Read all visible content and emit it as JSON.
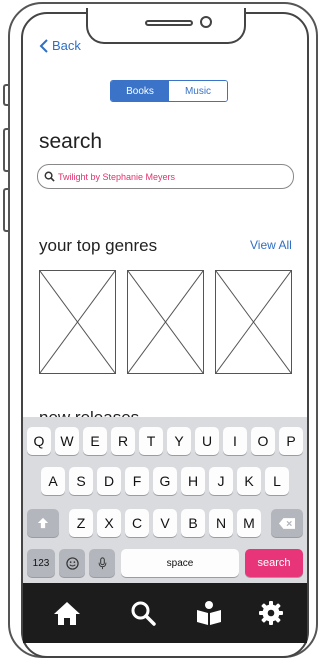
{
  "nav": {
    "back_label": "Back"
  },
  "segmented": {
    "options": [
      "Books",
      "Music"
    ],
    "selected": "Books"
  },
  "search": {
    "heading": "search",
    "query": "Twilight by Stephanie Meyers"
  },
  "genres": {
    "heading": "your top genres",
    "view_all_label": "View All",
    "tiles": 3
  },
  "new_releases": {
    "heading": "new releases"
  },
  "keyboard": {
    "row1": [
      "Q",
      "W",
      "E",
      "R",
      "T",
      "Y",
      "U",
      "I",
      "O",
      "P"
    ],
    "row2": [
      "A",
      "S",
      "D",
      "F",
      "G",
      "H",
      "J",
      "K",
      "L"
    ],
    "row3": [
      "Z",
      "X",
      "C",
      "V",
      "B",
      "N",
      "M"
    ],
    "numbers_label": "123",
    "space_label": "space",
    "search_label": "search"
  },
  "tabbar": {
    "items": [
      "home-icon",
      "search-icon",
      "library-icon",
      "settings-icon"
    ]
  },
  "colors": {
    "accent_blue": "#3a73c7",
    "search_pink": "#e8357a",
    "tabbar_bg": "#1c1c1c"
  }
}
